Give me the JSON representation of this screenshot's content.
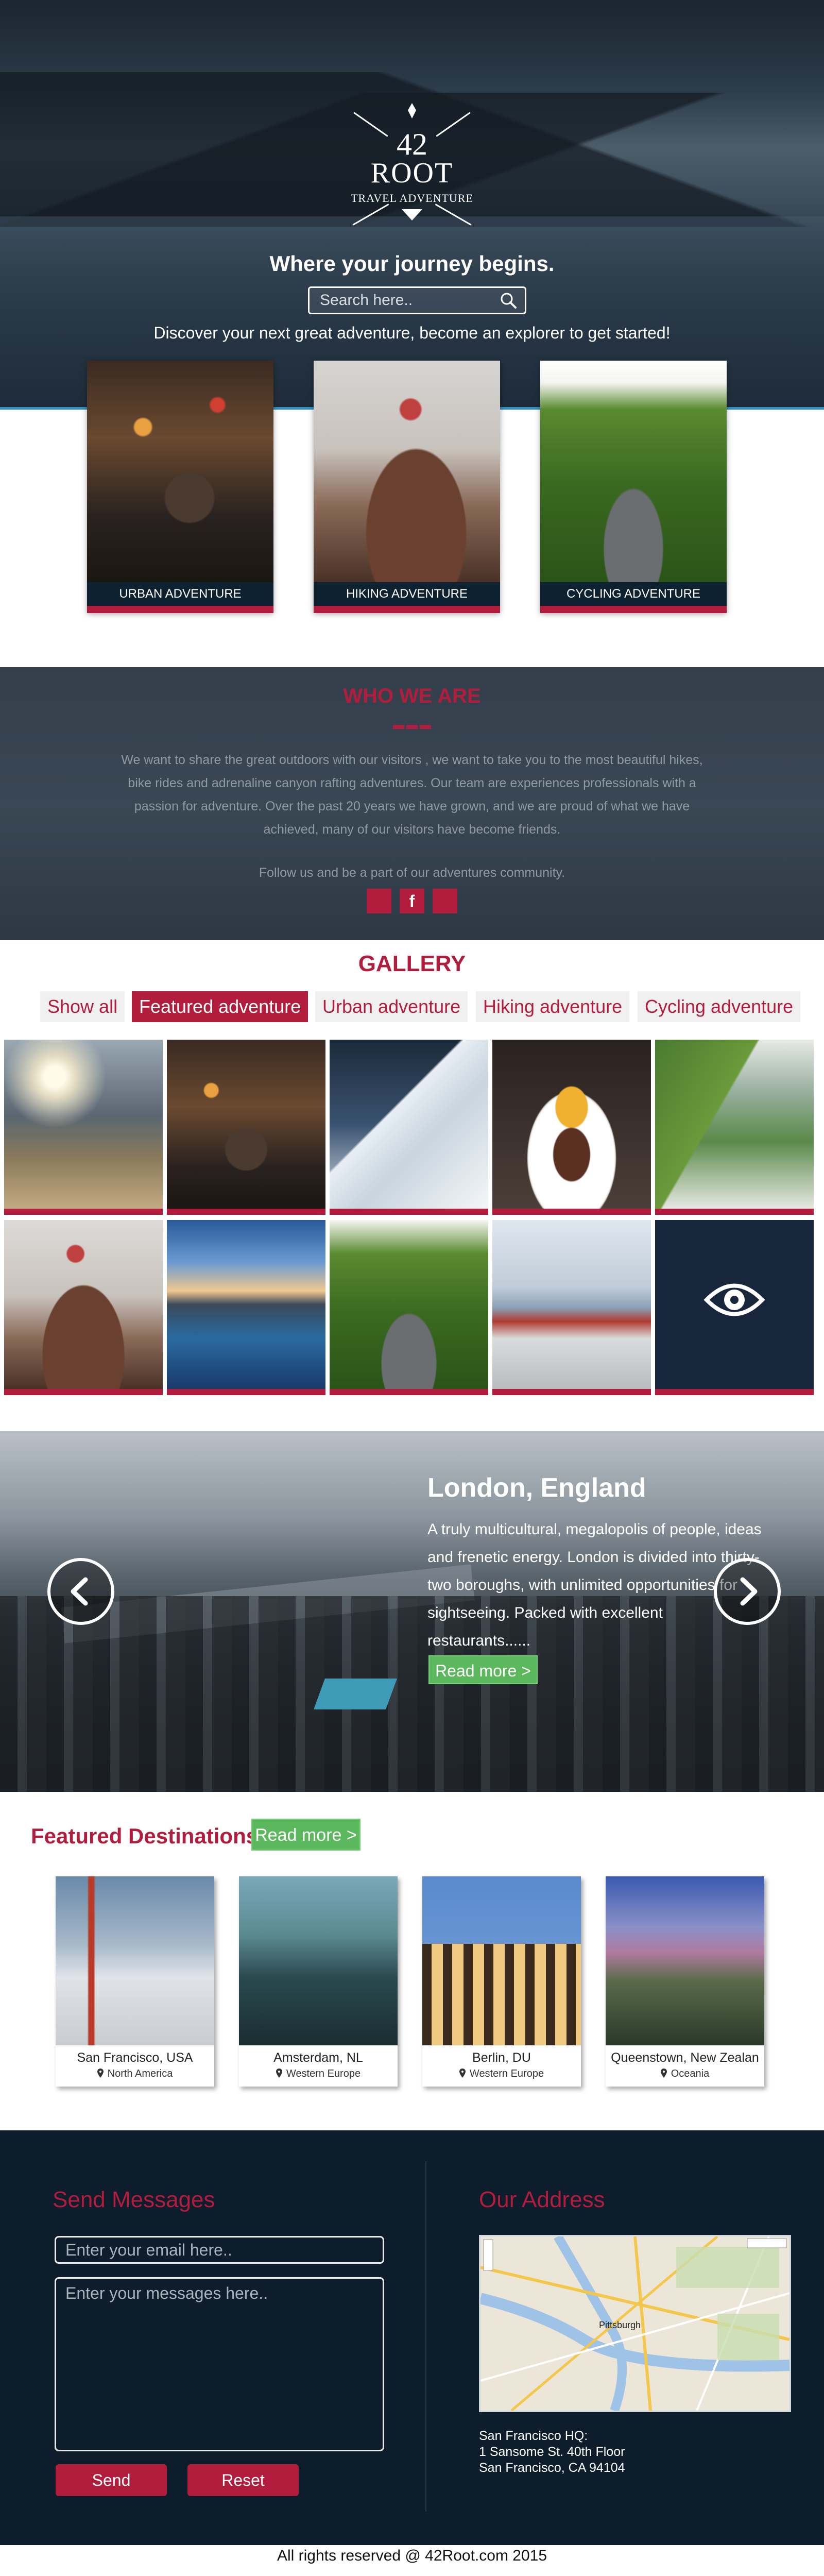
{
  "logo": {
    "number": "42",
    "name": "ROOT",
    "tagline": "TRAVEL ADVENTURE"
  },
  "hero": {
    "title": "Where your journey begins.",
    "search_placeholder": "Search here..",
    "subtitle": "Discover your next great adventure, become an explorer to get started!"
  },
  "categories": [
    {
      "label": "URBAN ADVENTURE"
    },
    {
      "label": "HIKING ADVENTURE"
    },
    {
      "label": "CYCLING ADVENTURE"
    }
  ],
  "about": {
    "title": "WHO WE ARE",
    "lines": [
      "We want to share the great outdoors with our visitors , we want to take you to the most beautiful hikes,",
      "bike rides and adrenaline canyon rafting adventures. Our team are experiences professionals with a",
      "passion for adventure. Over the past 20 years we have grown, and we are proud of what we have",
      "achieved, many of our visitors have become friends."
    ],
    "follow": "Follow us and be a part of our adventures community.",
    "facebook_glyph": "f"
  },
  "gallery": {
    "title": "GALLERY",
    "filters": [
      {
        "label": "Show all"
      },
      {
        "label": "Featured adventure"
      },
      {
        "label": "Urban adventure"
      },
      {
        "label": "Hiking adventure"
      },
      {
        "label": "Cycling adventure"
      }
    ],
    "active_filter": "Featured adventure"
  },
  "slider": {
    "title": "London, England",
    "description": "A truly multicultural, megalopolis of people, ideas and frenetic energy. London is divided into thirty-two boroughs, with unlimited opportunities for sightseeing. Packed with excellent restaurants......",
    "button": "Read more >"
  },
  "featured": {
    "title": "Featured Destinations",
    "button": "Read more >",
    "destinations": [
      {
        "name": "San Francisco, USA",
        "region": "North America"
      },
      {
        "name": "Amsterdam, NL",
        "region": "Western Europe"
      },
      {
        "name": "Berlin, DU",
        "region": "Western Europe"
      },
      {
        "name": "Queenstown, New Zealan",
        "region": "Oceania"
      }
    ]
  },
  "contact": {
    "send_title": "Send Messages",
    "email_placeholder": "Enter your email here..",
    "message_placeholder": "Enter your messages here..",
    "send_button": "Send",
    "reset_button": "Reset",
    "address_title": "Our Address",
    "address_lines": [
      "San Francisco HQ:",
      "1 Sansome St. 40th Floor",
      "San Francisco, CA 94104"
    ],
    "map_city_label": "Pittsburgh"
  },
  "footer": {
    "copyright": "All rights reserved @ 42Root.com 2015"
  },
  "colors": {
    "brand_red": "#b21d3d",
    "navy": "#0d2131",
    "green_button": "#5cb85c"
  }
}
